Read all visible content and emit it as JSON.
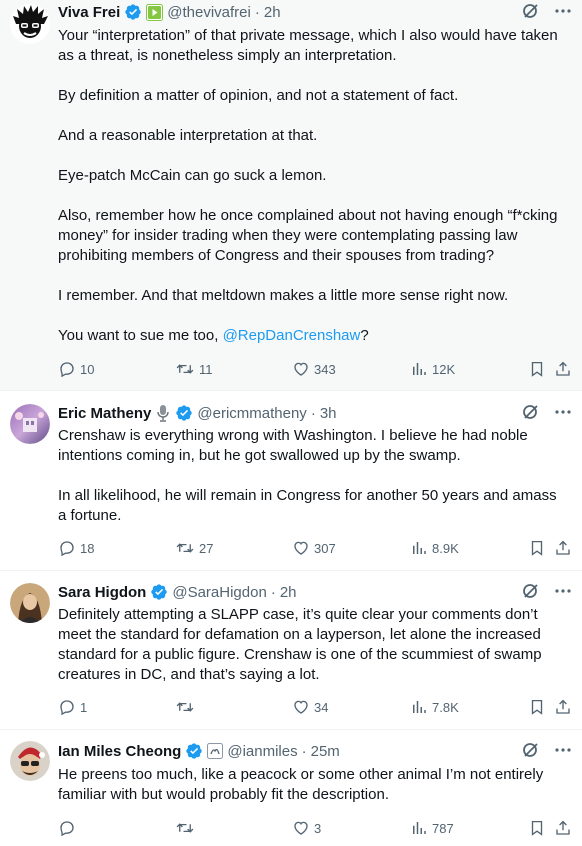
{
  "tweets": [
    {
      "name": "Viva Frei",
      "handle": "@thevivafrei",
      "time": "2h",
      "paragraphs": [
        "Your “interpretation” of that private message, which I also would have taken as a threat, is nonetheless simply an interpretation.",
        "By definition a matter of opinion, and not a statement of fact.",
        "And a reasonable interpretation at that.",
        "Eye-patch McCain can go suck a lemon.",
        "Also, remember how he once complained about not having enough “f*cking money” for insider trading when they were contemplating passing law prohibiting members of Congress and their spouses from trading?",
        "I remember. And that meltdown makes a little more sense right now."
      ],
      "last_line_prefix": "You want to sue me too, ",
      "mention": "@RepDanCrenshaw",
      "last_line_suffix": "?",
      "replies": "10",
      "retweets": "11",
      "likes": "343",
      "views": "12K"
    },
    {
      "name": "Eric Matheny",
      "handle": "@ericmmatheny",
      "time": "3h",
      "paragraphs": [
        "Crenshaw is everything wrong with Washington. I believe he had noble intentions coming in, but he got swallowed up by the swamp.",
        "In all likelihood, he will remain in Congress for another 50 years and amass a fortune."
      ],
      "replies": "18",
      "retweets": "27",
      "likes": "307",
      "views": "8.9K"
    },
    {
      "name": "Sara Higdon",
      "handle": "@SaraHigdon",
      "time": "2h",
      "paragraphs": [
        "Definitely attempting a SLAPP case, it’s quite clear your comments don’t meet the standard for defamation on a layperson, let alone the increased standard for a public figure. Crenshaw is one of the scummiest of swamp creatures in DC, and that’s saying a lot."
      ],
      "replies": "1",
      "retweets": "",
      "likes": "34",
      "views": "7.8K"
    },
    {
      "name": "Ian Miles Cheong",
      "handle": "@ianmiles",
      "time": "25m",
      "paragraphs": [
        "He preens too much, like a peacock or some other animal I’m not entirely familiar with but would probably fit the description."
      ],
      "replies": "",
      "retweets": "",
      "likes": "3",
      "views": "787"
    }
  ],
  "colors": {
    "verified": "#1d9bf0",
    "muted": "#536471",
    "link": "#1d9bf0",
    "text": "#0f1419"
  }
}
